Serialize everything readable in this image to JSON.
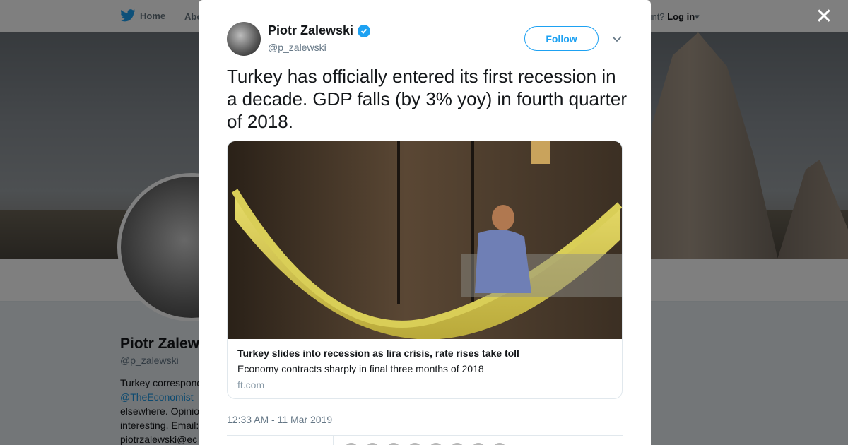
{
  "background": {
    "nav": {
      "home_label": "Home",
      "about_label": "Abo",
      "login_prompt": "ccount?",
      "login_label": "Log in"
    },
    "profile": {
      "name": "Piotr Zalews",
      "handle": "@p_zalewski",
      "bio_lines": [
        "Turkey correspond",
        "@TheEconomist",
        "elsewhere. Opinio",
        "interesting. Email:",
        "piotrzalewski@ec"
      ]
    }
  },
  "close_icon": "close-icon",
  "tweet": {
    "author": {
      "name": "Piotr Zalewski",
      "handle": "@p_zalewski",
      "verified": true
    },
    "follow_label": "Follow",
    "text": "Turkey has officially entered its first recession in a decade. GDP falls (by 3% yoy) in fourth quarter of 2018.",
    "card": {
      "image_alt": "photo-of-worker-assembling-aircraft-part",
      "title": "Turkey slides into recession as lira crisis, rate rises take toll",
      "description": "Economy contracts sharply in final three months of 2018",
      "domain": "ft.com"
    },
    "timestamp": "12:33 AM - 11 Mar 2019"
  },
  "colors": {
    "accent": "#1da1f2",
    "link": "#1b95e0",
    "muted": "#657786"
  }
}
